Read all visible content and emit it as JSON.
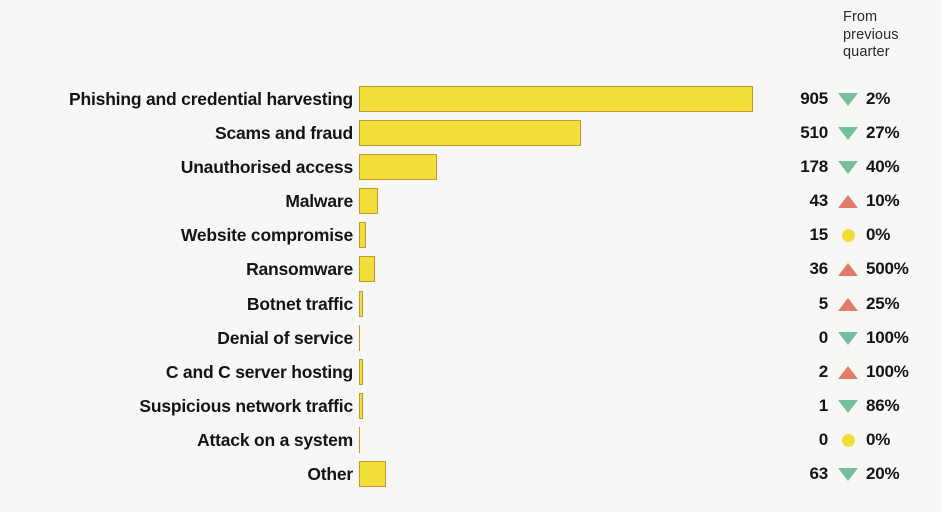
{
  "header": {
    "change_column_title": "From\nprevious\nquarter"
  },
  "colors": {
    "background": "#f7f7f5",
    "bar_fill": "#f2de3a",
    "bar_border": "#c8962c",
    "increase": "#e07a6b",
    "decrease": "#76bf9c",
    "no_change": "#f2dd38",
    "text": "#141414"
  },
  "chart_data": {
    "type": "bar",
    "title": "",
    "subtitle": "",
    "xlabel": "",
    "ylabel": "",
    "orientation": "horizontal",
    "grid": false,
    "legend": "none",
    "xlim": [
      0,
      905
    ],
    "categories": [
      "Phishing and credential harvesting",
      "Scams and fraud",
      "Unauthorised access",
      "Malware",
      "Website compromise",
      "Ransomware",
      "Botnet traffic",
      "Denial of service",
      "C and C server hosting",
      "Suspicious network traffic",
      "Attack on a system",
      "Other"
    ],
    "values": [
      905,
      510,
      178,
      43,
      15,
      36,
      5,
      0,
      2,
      1,
      0,
      63
    ],
    "annotations": {
      "change_direction": [
        "down",
        "down",
        "down",
        "up",
        "flat",
        "up",
        "up",
        "down",
        "up",
        "down",
        "flat",
        "down"
      ],
      "change_percent": [
        "2%",
        "27%",
        "40%",
        "10%",
        "0%",
        "500%",
        "25%",
        "100%",
        "100%",
        "86%",
        "0%",
        "20%"
      ]
    }
  },
  "rows": [
    {
      "label": "Phishing and credential harvesting",
      "value": "905",
      "direction": "down",
      "pct": "2%"
    },
    {
      "label": "Scams and fraud",
      "value": "510",
      "direction": "down",
      "pct": "27%"
    },
    {
      "label": "Unauthorised access",
      "value": "178",
      "direction": "down",
      "pct": "40%"
    },
    {
      "label": "Malware",
      "value": "43",
      "direction": "up",
      "pct": "10%"
    },
    {
      "label": "Website compromise",
      "value": "15",
      "direction": "flat",
      "pct": "0%"
    },
    {
      "label": "Ransomware",
      "value": "36",
      "direction": "up",
      "pct": "500%"
    },
    {
      "label": "Botnet traffic",
      "value": "5",
      "direction": "up",
      "pct": "25%"
    },
    {
      "label": "Denial of service",
      "value": "0",
      "direction": "down",
      "pct": "100%"
    },
    {
      "label": "C and C server hosting",
      "value": "2",
      "direction": "up",
      "pct": "100%"
    },
    {
      "label": "Suspicious network traffic",
      "value": "1",
      "direction": "down",
      "pct": "86%"
    },
    {
      "label": "Attack on a system",
      "value": "0",
      "direction": "flat",
      "pct": "0%"
    },
    {
      "label": "Other",
      "value": "63",
      "direction": "down",
      "pct": "20%"
    }
  ]
}
